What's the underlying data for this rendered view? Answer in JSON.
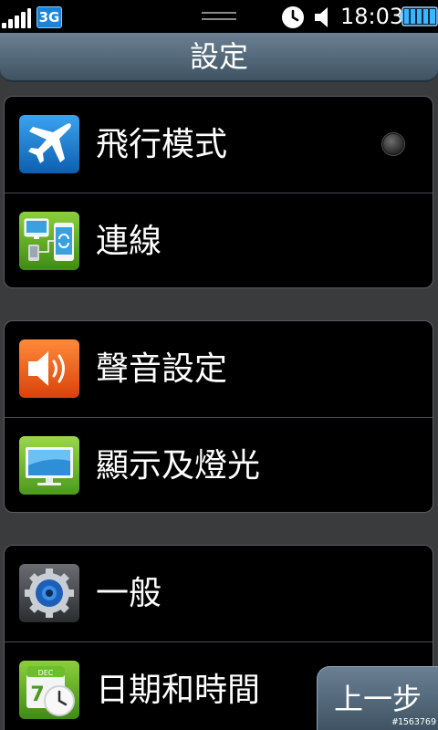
{
  "status_bar": {
    "network": "3G",
    "time": "18:03",
    "icons": [
      "signal-icon",
      "3g-icon",
      "drag-handle-icon",
      "alarm-icon",
      "volume-icon",
      "battery-icon"
    ]
  },
  "title_bar": {
    "title": "設定"
  },
  "groups": [
    {
      "items": [
        {
          "label": "飛行模式",
          "icon": "airplane-icon",
          "toggle": "off"
        },
        {
          "label": "連線",
          "icon": "connections-icon"
        }
      ]
    },
    {
      "items": [
        {
          "label": "聲音設定",
          "icon": "speaker-icon"
        },
        {
          "label": "顯示及燈光",
          "icon": "monitor-icon"
        }
      ]
    },
    {
      "items": [
        {
          "label": "一般",
          "icon": "gear-icon"
        },
        {
          "label": "日期和時間",
          "icon": "calendar-clock-icon",
          "icon_text": {
            "month": "DEC",
            "day": "7"
          }
        }
      ]
    }
  ],
  "back_button": {
    "label": "上一步"
  },
  "watermark": "#1563769",
  "colors": {
    "background": "#3a3b3d",
    "group_background": "#000000",
    "title_bar": "#52687a",
    "accent_blue": "#1b84d8"
  }
}
